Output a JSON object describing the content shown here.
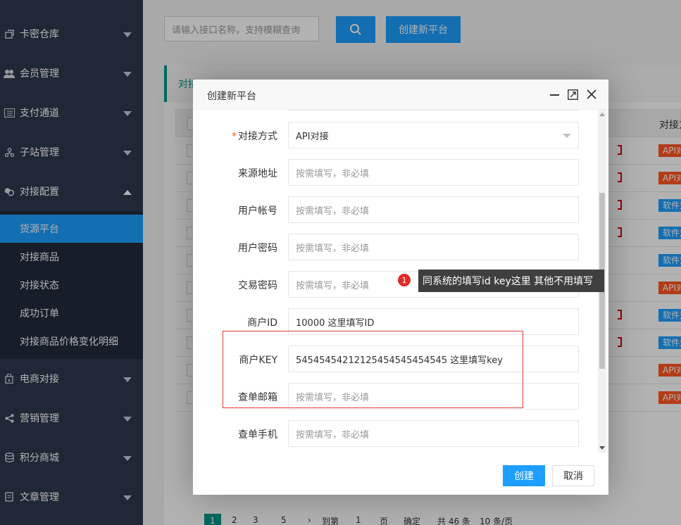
{
  "sidebar": {
    "items": [
      {
        "label": "卡密仓库",
        "icon": "stack-icon"
      },
      {
        "label": "会员管理",
        "icon": "users-icon"
      },
      {
        "label": "支付通道",
        "icon": "list-icon"
      },
      {
        "label": "子站管理",
        "icon": "sitemap-icon"
      },
      {
        "label": "对接配置",
        "icon": "link-icon"
      },
      {
        "label": "电商对接",
        "icon": "bag-icon"
      },
      {
        "label": "营销管理",
        "icon": "share-icon"
      },
      {
        "label": "积分商城",
        "icon": "coins-icon"
      },
      {
        "label": "文章管理",
        "icon": "document-icon"
      }
    ],
    "submenu": [
      "货源平台",
      "对接商品",
      "对接状态",
      "成功订单",
      "对接商品价格变化明细"
    ]
  },
  "toolbar": {
    "search_placeholder": "请输入接口名称，支持模糊查询",
    "create_label": "创建新平台"
  },
  "panel": {
    "tab_label": "对接",
    "column_header": "对接方式",
    "row_badges": [
      "API对接",
      "API对接",
      "软件对接",
      "软件对接",
      "软件对接",
      "API对接",
      "软件对接",
      "软件对接",
      "API对接",
      "API对接"
    ]
  },
  "pager": {
    "current": "1",
    "pages": [
      "2",
      "3",
      "5"
    ],
    "goto_label": "到第",
    "goto_value": "1",
    "page_unit": "页",
    "confirm": "确定",
    "total": "共 46 条",
    "per_page": "10 条/页"
  },
  "modal": {
    "title": "创建新平台",
    "fields": [
      {
        "label": "对接方式",
        "value": "API对接",
        "required": "*"
      },
      {
        "label": "来源地址",
        "placeholder": "按需填写，非必填"
      },
      {
        "label": "用户帐号",
        "placeholder": "按需填写，非必填"
      },
      {
        "label": "用户密码",
        "placeholder": "按需填写，非必填"
      },
      {
        "label": "交易密码",
        "placeholder": "按需填写，非必填"
      },
      {
        "label": "商户ID",
        "value": "10000 这里填写ID"
      },
      {
        "label": "商户KEY",
        "value": "54545454212125454545454545 这里填写key"
      },
      {
        "label": "查单邮箱",
        "placeholder": "按需填写，非必填"
      },
      {
        "label": "查单手机",
        "placeholder": "按需填写，非必填"
      }
    ],
    "ok_label": "创建",
    "cancel_label": "取消"
  },
  "annotation": {
    "badge": "1",
    "text": "同系统的填写id key这里 其他不用填写"
  },
  "colors": {
    "sidebar_bg": "#2f3a4f",
    "submenu_bg": "#222a3b",
    "accent": "#1e9fff",
    "api_badge": "#ff5722",
    "highlight_border": "#e03b3b"
  }
}
